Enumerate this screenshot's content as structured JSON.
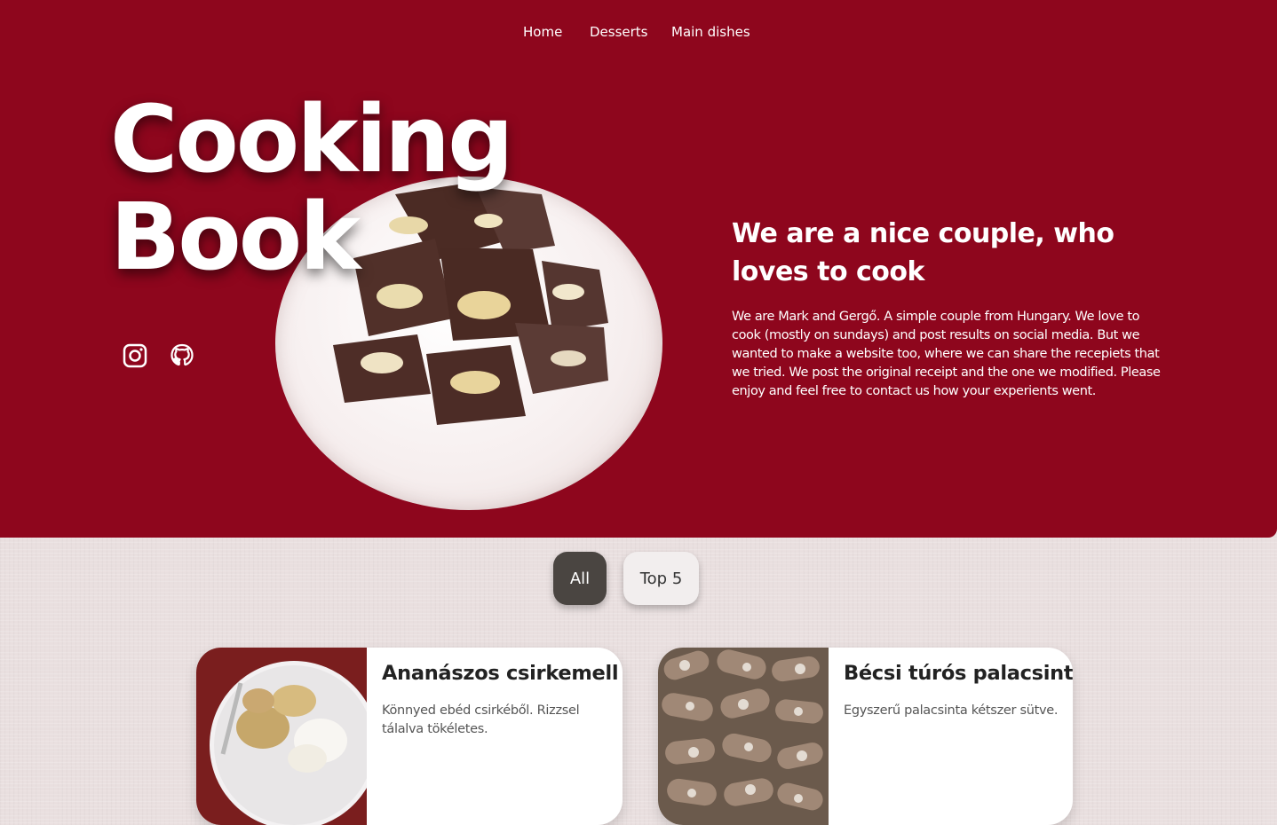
{
  "nav": {
    "items": [
      {
        "label": "Home"
      },
      {
        "label": "Desserts"
      },
      {
        "label": "Main dishes"
      }
    ]
  },
  "hero": {
    "title": "Cooking\nBook",
    "tagline": "We are a nice couple, who loves to cook",
    "about": "We are Mark and Gergő. A simple couple from Hungary. We love to cook (mostly on sundays) and post results on social media. But we wanted to make a website too, where we can share the recepiets that we tried. We post the original receipt and the one we modified. Please enjoy and feel free to contact us how your experients went.",
    "social": [
      {
        "icon": "instagram-icon"
      },
      {
        "icon": "github-icon"
      }
    ]
  },
  "filters": [
    {
      "label": "All",
      "active": true
    },
    {
      "label": "Top 5",
      "active": false
    }
  ],
  "recipes": [
    {
      "title": "Ananászos csirkemell",
      "description": "Könnyed ebéd csirkéből. Rizzsel tálalva tökéletes."
    },
    {
      "title": "Bécsi túrós palacsinta",
      "description": "Egyszerű palacsinta kétszer sütve."
    }
  ],
  "colors": {
    "hero_bg": "#8e061d",
    "page_bg": "#e9dfdf",
    "active_filter": "#4a4541",
    "inactive_filter": "#f2eeee"
  }
}
